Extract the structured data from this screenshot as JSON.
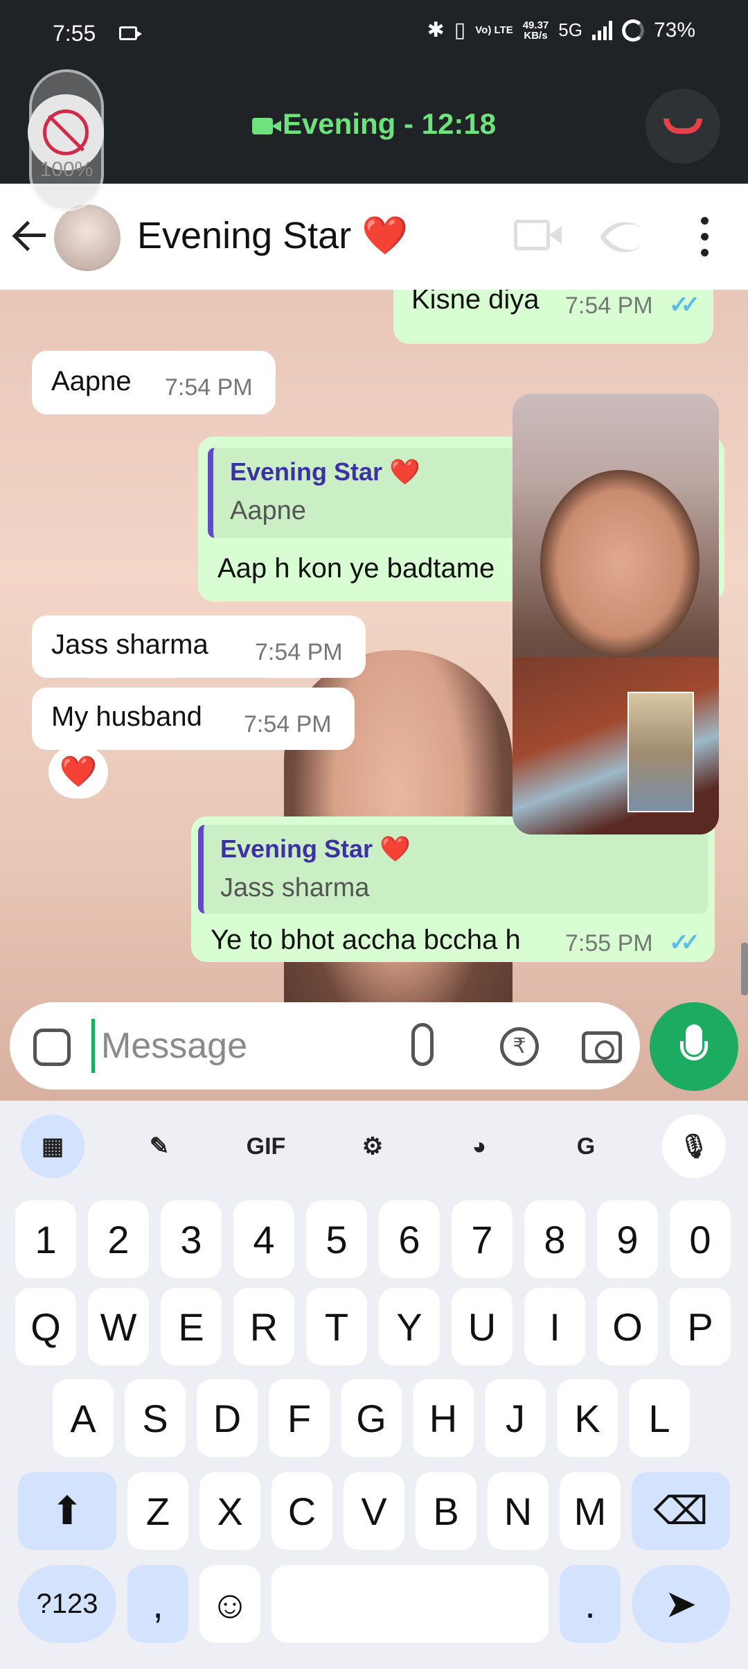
{
  "status_bar": {
    "time": "7:55",
    "speed_value": "49.37",
    "speed_unit": "KB/s",
    "volte": "Vo) LTE",
    "network": "5G",
    "battery": "73%"
  },
  "call": {
    "title": "Evening - 12:18",
    "mute_percent": "100%",
    "accent_color": "#6ee27c",
    "end_call_color": "#e8414b"
  },
  "header": {
    "contact_name": "Evening Star ❤️"
  },
  "messages": [
    {
      "dir": "out",
      "text": "Kisne diya",
      "time": "7:54 PM"
    },
    {
      "dir": "in",
      "text": "Aapne",
      "time": "7:54 PM"
    },
    {
      "dir": "out",
      "quote_name": "Evening Star ❤️",
      "quote_text": "Aapne",
      "text": "Aap h kon ye badtame"
    },
    {
      "dir": "in",
      "text": "Jass sharma",
      "time": "7:54 PM"
    },
    {
      "dir": "in",
      "text": "My husband",
      "time": "7:54 PM",
      "reaction": "❤️"
    },
    {
      "dir": "out",
      "quote_name": "Evening Star ❤️",
      "quote_text": "Jass sharma",
      "text": "Ye to bhot accha bccha h",
      "time": "7:55 PM"
    }
  ],
  "input": {
    "placeholder": "Message",
    "rupee": "₹"
  },
  "keyboard": {
    "toolbar": {
      "gif": "GIF"
    },
    "row_numbers": [
      "1",
      "2",
      "3",
      "4",
      "5",
      "6",
      "7",
      "8",
      "9",
      "0"
    ],
    "row1": [
      "Q",
      "W",
      "E",
      "R",
      "T",
      "Y",
      "U",
      "I",
      "O",
      "P"
    ],
    "row2": [
      "A",
      "S",
      "D",
      "F",
      "G",
      "H",
      "J",
      "K",
      "L"
    ],
    "row3": [
      "Z",
      "X",
      "C",
      "V",
      "B",
      "N",
      "M"
    ],
    "bottom": {
      "symbols": "?123",
      "comma": ",",
      "emoji": "☺",
      "period": "."
    }
  }
}
